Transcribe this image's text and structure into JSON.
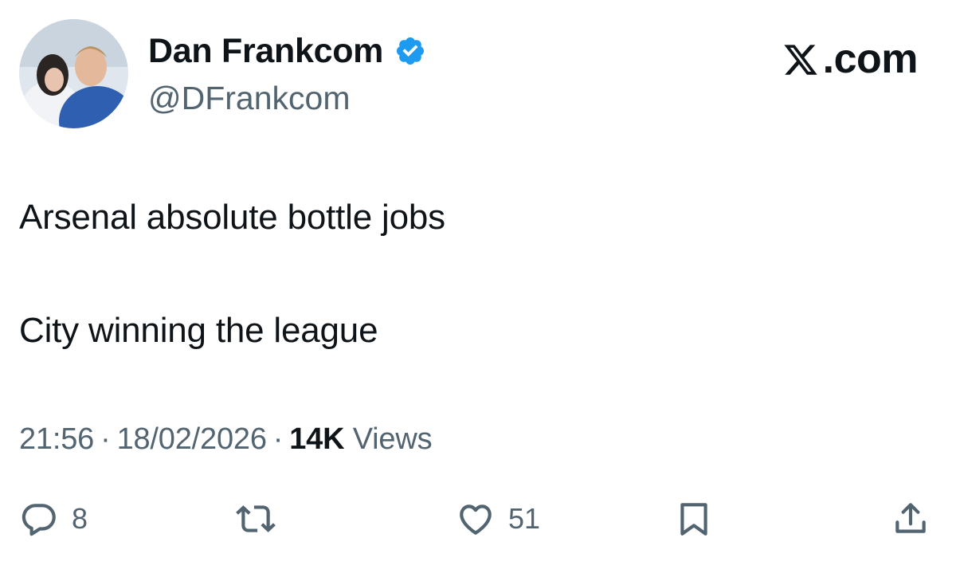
{
  "author": {
    "display_name": "Dan Frankcom",
    "handle": "@DFrankcom",
    "verified": true
  },
  "brand": {
    "label": ".com"
  },
  "tweet": {
    "lines": [
      "Arsenal absolute bottle jobs",
      "City winning the league"
    ]
  },
  "meta": {
    "time": "21:56",
    "date": "18/02/2026",
    "views_count": "14K",
    "views_label": "Views",
    "separator": "·"
  },
  "actions": {
    "replies": "8",
    "likes": "51"
  },
  "colors": {
    "text": "#0f1419",
    "secondary": "#536471",
    "verified_blue": "#1d9bf0"
  },
  "icons": [
    "verified-badge-icon",
    "x-logo-icon",
    "reply-icon",
    "retweet-icon",
    "like-icon",
    "bookmark-icon",
    "share-icon"
  ]
}
